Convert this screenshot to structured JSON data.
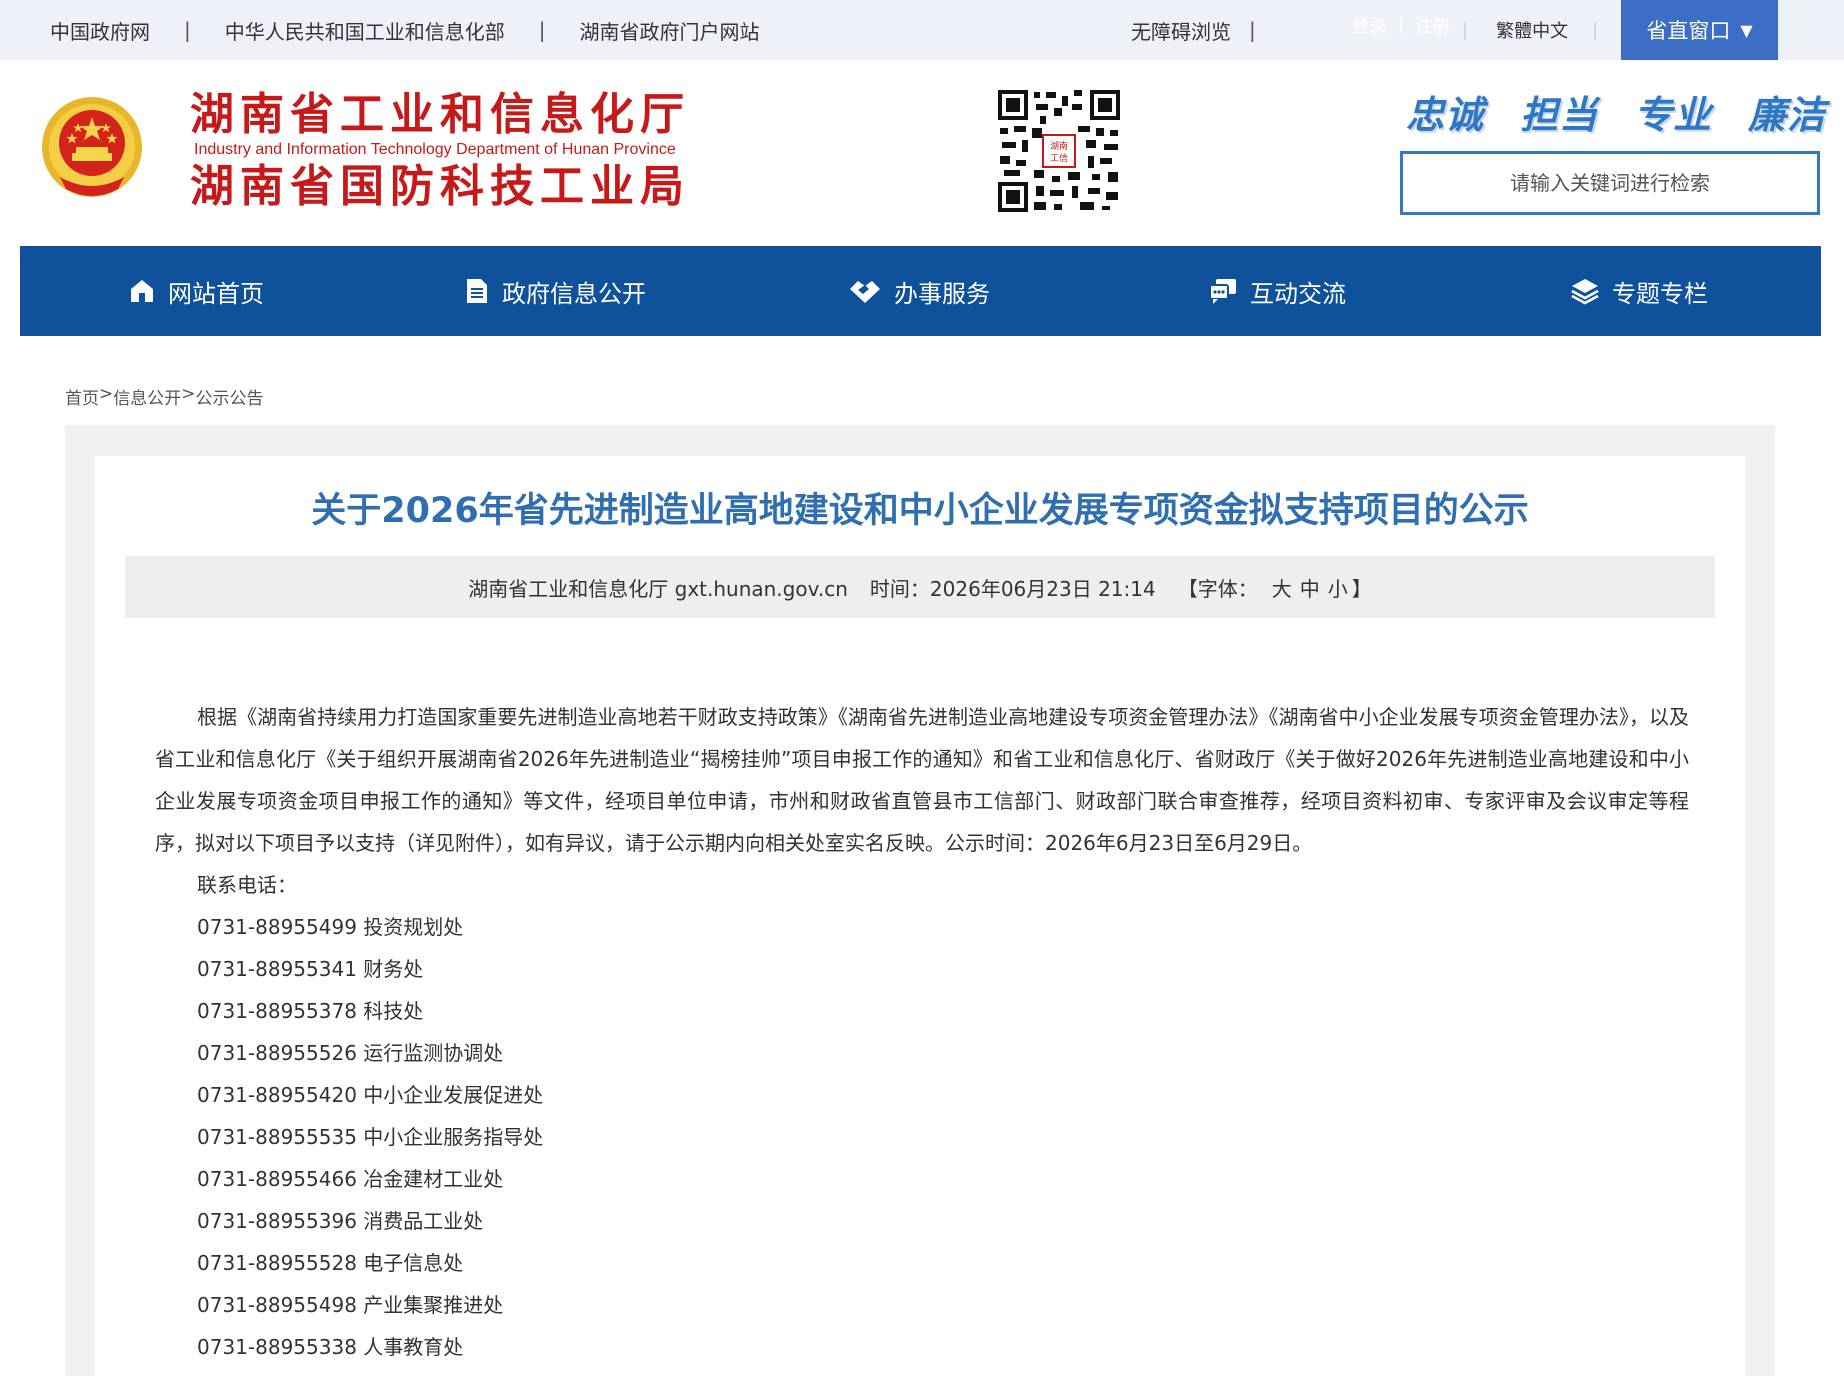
{
  "topbar": {
    "links": [
      "中国政府网",
      "中华人民共和国工业和信息化部",
      "湖南省政府门户网站"
    ],
    "accessibility": "无障碍浏览",
    "login": "登录",
    "register": "注册",
    "traditional": "繁體中文",
    "window_button": "省直窗口"
  },
  "header": {
    "title_line1": "湖南省工业和信息化厅",
    "title_en": "Industry and Information Technology Department of Hunan Province",
    "title_line2": "湖南省国防科技工业局",
    "slogans": [
      "忠诚",
      "担当",
      "专业",
      "廉洁"
    ],
    "search_placeholder": "请输入关键词进行检索"
  },
  "nav": {
    "items": [
      {
        "label": "网站首页",
        "icon": "home-icon"
      },
      {
        "label": "政府信息公开",
        "icon": "document-icon"
      },
      {
        "label": "办事服务",
        "icon": "handshake-icon"
      },
      {
        "label": "互动交流",
        "icon": "chat-icon"
      },
      {
        "label": "专题专栏",
        "icon": "layers-icon"
      }
    ]
  },
  "breadcrumb": {
    "items": [
      "首页",
      "信息公开",
      "公示公告"
    ],
    "separator": ">"
  },
  "article": {
    "title": "关于2026年省先进制造业高地建设和中小企业发展专项资金拟支持项目的公示",
    "source": "湖南省工业和信息化厅 gxt.hunan.gov.cn",
    "time": "时间：2026年06月23日 21:14",
    "font_label": "【字体：",
    "font_large": "大",
    "font_medium": "中",
    "font_small": "小",
    "font_close": "】",
    "paragraph": "根据《湖南省持续用力打造国家重要先进制造业高地若干财政支持政策》《湖南省先进制造业高地建设专项资金管理办法》《湖南省中小企业发展专项资金管理办法》，以及省工业和信息化厅《关于组织开展湖南省2026年先进制造业“揭榜挂帅”项目申报工作的通知》和省工业和信息化厅、省财政厅《关于做好2026年先进制造业高地建设和中小企业发展专项资金项目申报工作的通知》等文件，经项目单位申请，市州和财政省直管县市工信部门、财政部门联合审查推荐，经项目资料初审、专家评审及会议审定等程序，拟对以下项目予以支持（详见附件），如有异议，请于公示期内向相关处室实名反映。公示时间：2026年6月23日至6月29日。",
    "contact_label": "联系电话：",
    "contacts": [
      "0731-88955499  投资规划处",
      "0731-88955341  财务处",
      "0731-88955378  科技处",
      "0731-88955526  运行监测协调处",
      "0731-88955420  中小企业发展促进处",
      "0731-88955535  中小企业服务指导处",
      "0731-88955466  冶金建材工业处",
      "0731-88955396  消费品工业处",
      "0731-88955528  电子信息处",
      "0731-88955498  产业集聚推进处",
      "0731-88955338  人事教育处"
    ]
  },
  "colors": {
    "nav_bg": "#0f519b",
    "title_red": "#c61a1a",
    "article_title": "#2f6fb0",
    "window_button": "#3b6ec4"
  }
}
